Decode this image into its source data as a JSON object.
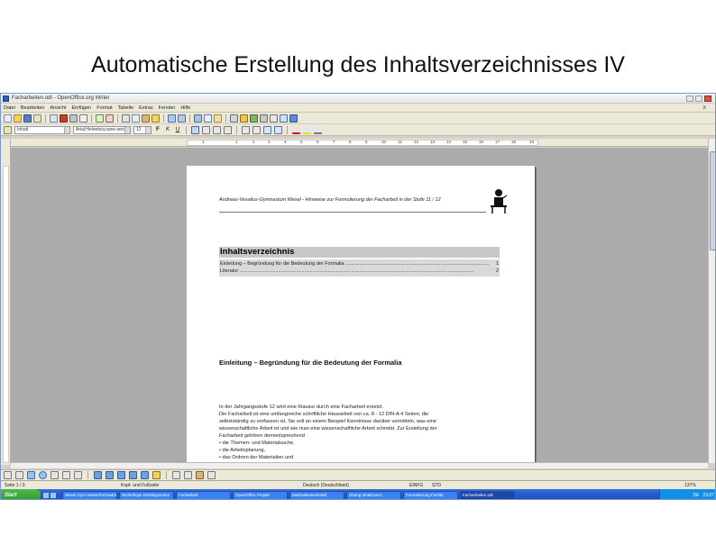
{
  "slide": {
    "title": "Automatische Erstellung des Inhaltsverzeichnisses IV"
  },
  "window": {
    "title": "Facharbeiten.odt - OpenOffice.org Writer"
  },
  "menu": {
    "items": [
      "Datei",
      "Bearbeiten",
      "Ansicht",
      "Einfügen",
      "Format",
      "Tabelle",
      "Extras",
      "Fenster",
      "Hilfe"
    ],
    "close_doc": "X"
  },
  "format_bar": {
    "style_value": "Inhalt",
    "font_value": "Arial;Helvetica;sans-serif",
    "size_value": "12",
    "bold": "F",
    "italic": "K",
    "underline": "U"
  },
  "ruler": {
    "ticks": [
      "1",
      "1",
      "2",
      "3",
      "4",
      "5",
      "6",
      "7",
      "8",
      "9",
      "10",
      "11",
      "12",
      "13",
      "14",
      "15",
      "16",
      "17",
      "18",
      "19"
    ]
  },
  "document": {
    "header_text": "Andreas-Vesalius-Gymnasium Wesel - Hinweise zur Formulierung der Facharbeit in der Stufe 11 / 12",
    "toc_title": "Inhaltsverzeichnis",
    "toc_entries": [
      {
        "text": "Einleitung – Begründung für die Bedeutung der Formalia",
        "page": "1"
      },
      {
        "text": "Literatur",
        "page": "2"
      }
    ],
    "heading": "Einleitung – Begründung für die Bedeutung der Formalia",
    "paragraph_lines": [
      "In der Jahrgangsstufe 12 wird eine Klausur durch eine Facharbeit ersetzt.",
      "Die Facharbeit ist eine umfangreiche schriftliche Hausarbeit von ca. 8 - 12 DIN-A 4 Seiten, die",
      "selbstständig zu verfassen ist. Sie soll an einem Beispiel Kenntnisse darüber vermitteln, was eine",
      "wissenschaftliche Arbeit ist und wie man eine wissenschaftliche Arbeit schreibt. Zur Erstellung der",
      "Facharbeit gehören dementsprechend",
      "• die Themen- und Materialsuche,",
      "• die Arbeitsplanung,",
      "• das Ordnen der Materialien und"
    ]
  },
  "statusbar": {
    "page": "Seite 1 / 3",
    "style": "Kopf- und Fußzeile",
    "language": "Deutsch (Deutschland)",
    "mode": "EINFG",
    "std": "STD",
    "zoom": "137%"
  },
  "taskbar": {
    "start": "Start",
    "tasks": [
      "Wesel Gym Noten/Fachwahl...",
      "Workshops Einstiegsnoten",
      "Facharbeit",
      "OpenOffice Projekt",
      "Methodenwerkstatt",
      "Übung Inhaltsverz...",
      "Formatierung Fachtit",
      "Facharbeiten.odt"
    ],
    "tray_lang": "DE",
    "clock": "23:07"
  },
  "colors": {
    "workspace": "#ababab",
    "toc_title_bg": "#c8c8c8",
    "toc_body_bg": "#d9d9d9",
    "taskbar": "#245dd0",
    "start_button": "#2f9b2e"
  }
}
